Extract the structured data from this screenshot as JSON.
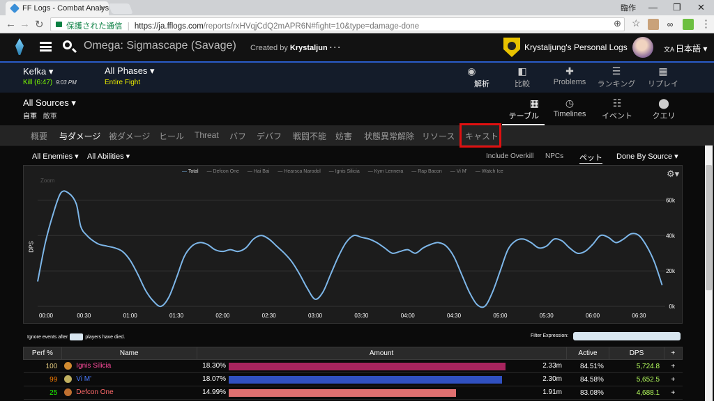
{
  "browser": {
    "tab_title": "FF Logs - Combat Analys",
    "tab_close": "×",
    "win_min": "—",
    "win_max": "❐",
    "win_close": "✕",
    "user_badge": "臨作",
    "url_secure_label": "保護された通信",
    "url_separator": "|",
    "url_host": "https://ja.fflogs.com",
    "url_path": "/reports/rxHVqjCdQ2mAPR6N#fight=10&type=damage-done",
    "back": "←",
    "forward": "→",
    "reload": "↻",
    "star": "☆",
    "menu": "⋮"
  },
  "site_header": {
    "zone_title": "Omega: Sigmascape (Savage)",
    "created_by_label": "Created by",
    "created_by_user": "Krystaljun ᐧ ᐧ ᐧ",
    "personal_logs": "Krystaljung's Personal Logs",
    "language": "日本語 ▾",
    "lang_icon": "文A"
  },
  "report_header": {
    "boss": "Kefka ▾",
    "kill": "Kill (6:47)",
    "kill_time": "9:03 PM",
    "phases": "All Phases ▾",
    "entire_fight": "Entire Fight",
    "nav": [
      {
        "label": "解析",
        "icon": "◉"
      },
      {
        "label": "比較",
        "icon": "◧"
      },
      {
        "label": "Problems",
        "icon": "✚"
      },
      {
        "label": "ランキング",
        "icon": "☰"
      },
      {
        "label": "リプレイ",
        "icon": "▦"
      }
    ]
  },
  "sources_row": {
    "all_sources": "All Sources ▾",
    "friendly": "自軍",
    "enemies": "敵軍",
    "views": [
      {
        "label": "テーブル",
        "icon": "▦"
      },
      {
        "label": "Timelines",
        "icon": "◷"
      },
      {
        "label": "イベント",
        "icon": "☷"
      },
      {
        "label": "クエリ",
        "icon": "⬤"
      }
    ]
  },
  "content_tabs": [
    "概要",
    "与ダメージ",
    "被ダメージ",
    "ヒール",
    "Threat",
    "バフ",
    "デバフ",
    "戦闘不能",
    "妨害",
    "状態異常解除",
    "リソース",
    "キャスト"
  ],
  "filters": {
    "enemies": "All Enemies ▾",
    "abilities": "All Abilities ▾",
    "include_overkill": "Include Overkill",
    "npcs": "NPCs",
    "pets": "ペット",
    "done_by": "Done By Source ▾"
  },
  "chart_data": {
    "type": "line",
    "title": "",
    "xlabel": "",
    "ylabel": "DPS",
    "zoom_label": "Zoom",
    "gear_icon": "⚙▾",
    "legend": [
      "Total",
      "Defcon One",
      "Hai Bai",
      "Hearsca Narodol",
      "Ignis Silicia",
      "Kym Lennera",
      "Rap Bacon",
      "Vi M'",
      "Watch Ice"
    ],
    "x_ticks": [
      "00:00",
      "00:30",
      "01:00",
      "01:30",
      "02:00",
      "02:30",
      "03:00",
      "03:30",
      "04:00",
      "04:30",
      "05:00",
      "05:30",
      "06:00",
      "06:30"
    ],
    "y_ticks": [
      "0k",
      "20k",
      "40k",
      "60k"
    ],
    "ylim": [
      0,
      70000
    ],
    "xlim": [
      0,
      407
    ],
    "series": [
      {
        "name": "Total",
        "color": "#7db6e8",
        "x": [
          0,
          5,
          10,
          15,
          20,
          25,
          28,
          32,
          36,
          40,
          45,
          50,
          55,
          60,
          65,
          70,
          75,
          80,
          85,
          90,
          95,
          100,
          105,
          110,
          115,
          120,
          125,
          130,
          135,
          140,
          145,
          150,
          155,
          160,
          165,
          170,
          175,
          180,
          185,
          190,
          195,
          200,
          205,
          210,
          215,
          220,
          225,
          230,
          235,
          240,
          245,
          250,
          255,
          260,
          265,
          270,
          275,
          280,
          285,
          290,
          295,
          300,
          305,
          310,
          315,
          320,
          325,
          330,
          335,
          340,
          345,
          350,
          355,
          360,
          365,
          370,
          375,
          380,
          385,
          390,
          395,
          400,
          405
        ],
        "values": [
          14000,
          36000,
          52000,
          64000,
          64000,
          58000,
          45000,
          40000,
          37000,
          35000,
          34000,
          33000,
          31000,
          26000,
          18000,
          9000,
          3000,
          0,
          5000,
          16000,
          28000,
          34000,
          36000,
          35000,
          32000,
          31000,
          32000,
          31000,
          33000,
          38000,
          40000,
          38000,
          34000,
          30000,
          25000,
          18000,
          10000,
          4000,
          8000,
          18000,
          28000,
          36000,
          40000,
          39000,
          38000,
          36000,
          33000,
          30000,
          31000,
          32000,
          30000,
          33000,
          35000,
          36000,
          34000,
          28000,
          18000,
          8000,
          1000,
          0,
          8000,
          20000,
          32000,
          37000,
          38000,
          36000,
          33000,
          34000,
          38000,
          37000,
          33000,
          30000,
          31000,
          35000,
          40000,
          39000,
          36000,
          38000,
          41000,
          40000,
          34000,
          25000,
          12000
        ]
      }
    ]
  },
  "options": {
    "ignore_before": "Ignore events after",
    "ignore_after": "players have died.",
    "filter_expression": "Filter Expression:"
  },
  "table": {
    "headers": [
      "Perf %",
      "Name",
      "Amount",
      "Active",
      "DPS",
      "+"
    ],
    "rows": [
      {
        "perf": "100",
        "perf_color": "#e5cc80",
        "name": "Ignis Silicia",
        "name_color": "#ff4a9c",
        "icon_color": "#d08a30",
        "pct": "18.30%",
        "bar_fraction": 0.9153,
        "bar_color": "#a8245e",
        "amount": "2.33m",
        "active": "84.51%",
        "dps": "5,724.8",
        "plus": "+"
      },
      {
        "perf": "99",
        "perf_color": "#ff8000",
        "name": "Vi M'",
        "name_color": "#4a7cff",
        "icon_color": "#c0b060",
        "pct": "18.07%",
        "bar_fraction": 0.9038,
        "bar_color": "#3050c0",
        "amount": "2.30m",
        "active": "84.58%",
        "dps": "5,652.5",
        "plus": "+"
      },
      {
        "perf": "25",
        "perf_color": "#1eff00",
        "name": "Defcon One",
        "name_color": "#ff6a6a",
        "icon_color": "#c07030",
        "pct": "14.99%",
        "bar_fraction": 0.75,
        "bar_color": "#e07070",
        "amount": "1.91m",
        "active": "83.08%",
        "dps": "4,688.1",
        "plus": "+"
      }
    ]
  }
}
